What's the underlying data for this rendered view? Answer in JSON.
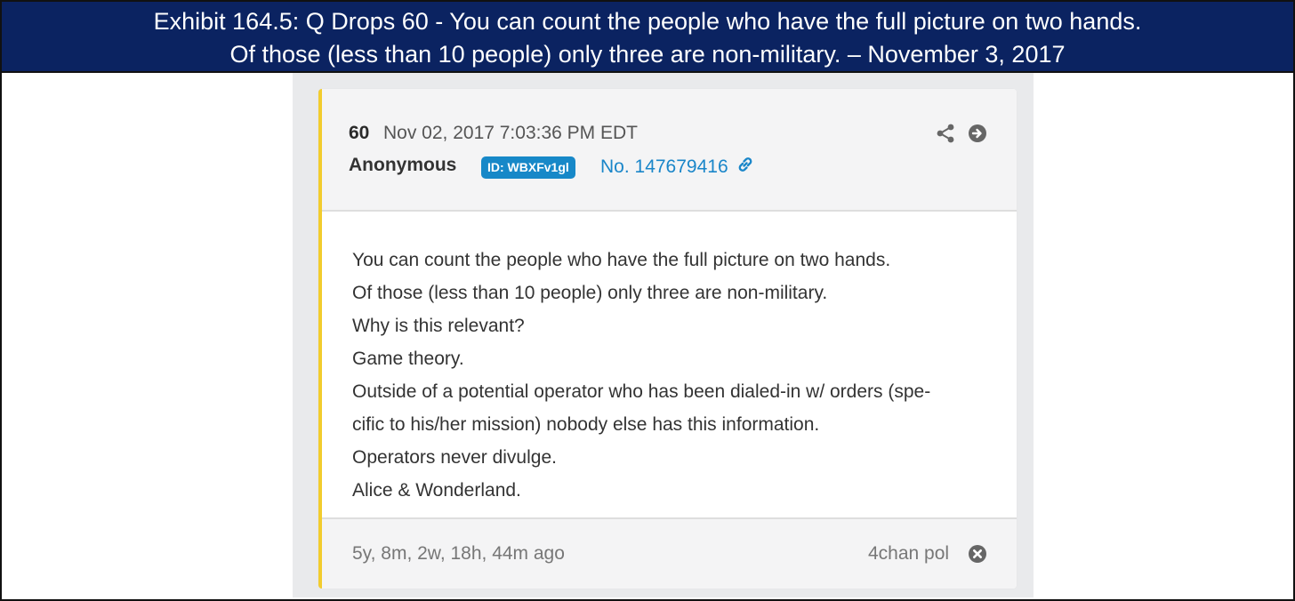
{
  "banner": {
    "line1": "Exhibit 164.5: Q Drops 60 - You can count the people who have the full picture on two hands.",
    "line2": "Of those (less than 10 people) only three are non-military. – November 3, 2017"
  },
  "post": {
    "number": "60",
    "date": "Nov 02, 2017 7:03:36 PM EDT",
    "author": "Anonymous",
    "id_badge": "ID: WBXFv1gl",
    "post_link": "No. 147679416",
    "body_lines": [
      "You can count the people who have the full picture on two hands.",
      "Of those (less than 10 people) only three are non-military.",
      "Why is this relevant?",
      "Game theory.",
      "Outside of a potential operator who has been dialed-in w/ orders (spe-",
      "cific to his/her mission) nobody else has this information.",
      "Operators never divulge.",
      "Alice & Wonderland."
    ],
    "age": "5y, 8m, 2w, 18h, 44m ago",
    "source": "4chan pol"
  },
  "icons": {
    "share": "share-icon",
    "goto": "arrow-right-circle-icon",
    "link": "link-icon",
    "close": "close-circle-icon"
  },
  "colors": {
    "banner_bg": "#0b2361",
    "accent_border": "#f2cc2e",
    "id_badge_bg": "#1788c8",
    "link": "#1a86c9"
  }
}
